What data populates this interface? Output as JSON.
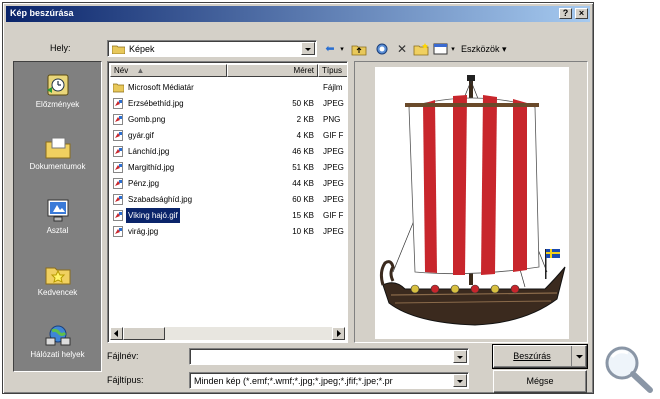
{
  "window": {
    "title": "Kép beszúrása",
    "help_btn": "?",
    "close_btn": "×"
  },
  "location": {
    "label": "Hely:",
    "value": "Képek"
  },
  "toolbar": {
    "tools_label": "Eszközök"
  },
  "places": [
    {
      "label": "Előzmények",
      "icon": "history-icon"
    },
    {
      "label": "Dokumentumok",
      "icon": "documents-folder-icon"
    },
    {
      "label": "Asztal",
      "icon": "desktop-icon"
    },
    {
      "label": "Kedvencek",
      "icon": "favorites-folder-icon"
    },
    {
      "label": "Hálózati helyek",
      "icon": "network-places-icon"
    }
  ],
  "filelist": {
    "columns": {
      "name": "Név",
      "size": "Méret",
      "type": "Típus"
    },
    "rows": [
      {
        "name": "Microsoft Médiatár",
        "size": "",
        "type": "Fájlm",
        "kind": "folder",
        "selected": false
      },
      {
        "name": "Erzsébethíd.jpg",
        "size": "50 KB",
        "type": "JPEG",
        "kind": "image",
        "selected": false
      },
      {
        "name": "Gomb.png",
        "size": "2 KB",
        "type": "PNG",
        "kind": "image",
        "selected": false
      },
      {
        "name": "gyár.gif",
        "size": "4 KB",
        "type": "GIF F",
        "kind": "image",
        "selected": false
      },
      {
        "name": "Lánchíd.jpg",
        "size": "46 KB",
        "type": "JPEG",
        "kind": "image",
        "selected": false
      },
      {
        "name": "Margithíd.jpg",
        "size": "51 KB",
        "type": "JPEG",
        "kind": "image",
        "selected": false
      },
      {
        "name": "Pénz.jpg",
        "size": "44 KB",
        "type": "JPEG",
        "kind": "image",
        "selected": false
      },
      {
        "name": "Szabadsághíd.jpg",
        "size": "60 KB",
        "type": "JPEG",
        "kind": "image",
        "selected": false
      },
      {
        "name": "Viking hajó.gif",
        "size": "15 KB",
        "type": "GIF F",
        "kind": "image",
        "selected": true
      },
      {
        "name": "virág.jpg",
        "size": "10 KB",
        "type": "JPEG",
        "kind": "image",
        "selected": false
      }
    ]
  },
  "filename": {
    "label": "Fájlnév:",
    "value": ""
  },
  "filetype": {
    "label": "Fájltípus:",
    "value": "Minden kép (*.emf;*.wmf;*.jpg;*.jpeg;*.jfif;*.jpe;*.pr"
  },
  "buttons": {
    "insert": "Beszúrás",
    "cancel": "Mégse"
  },
  "colors": {
    "title_start": "#0a246a",
    "title_end": "#a6caf0",
    "dialog_face": "#d4d0c8",
    "places_bg": "#808080",
    "selection": "#0a246a",
    "sail_red": "#c8262c"
  }
}
